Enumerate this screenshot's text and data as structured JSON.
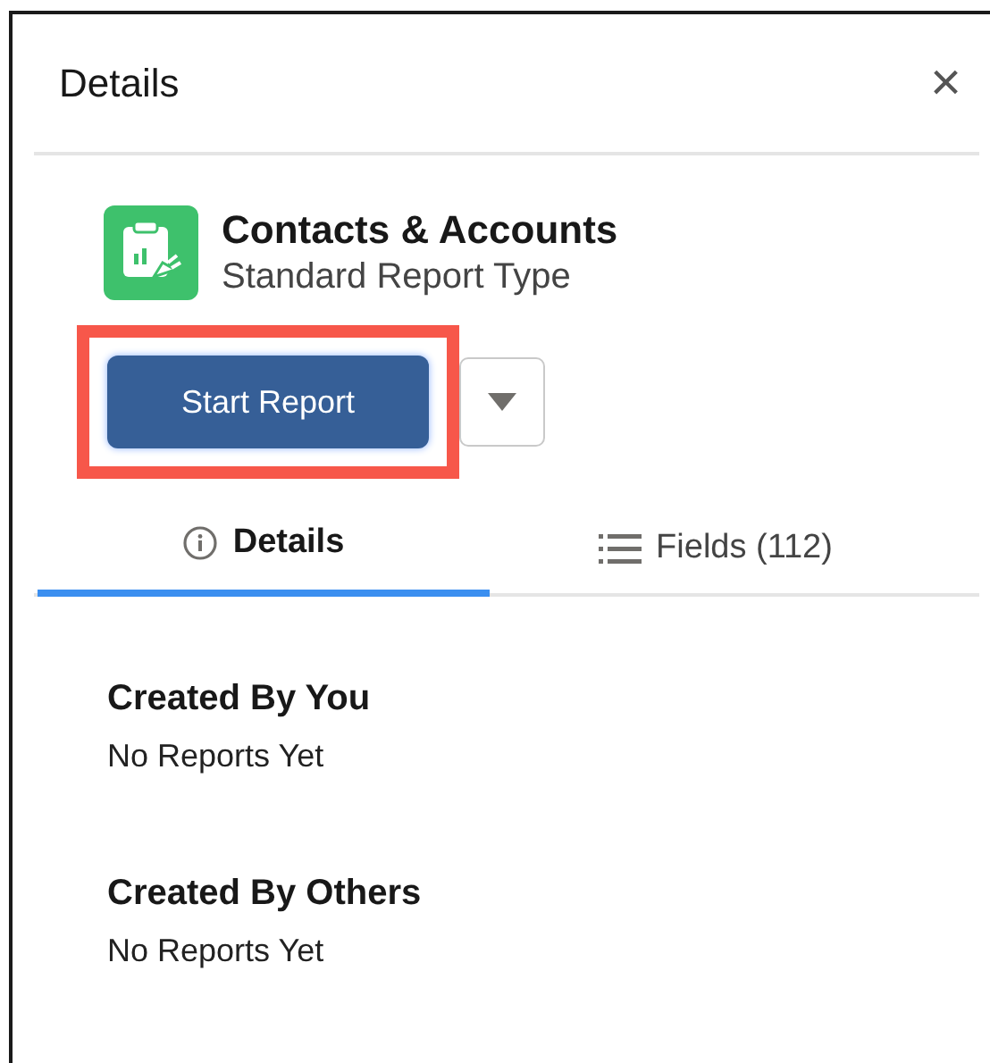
{
  "panel": {
    "title": "Details",
    "close": "×"
  },
  "report_type": {
    "name": "Contacts & Accounts",
    "subtitle": "Standard Report Type"
  },
  "start_button": {
    "label": "Start Report",
    "highlighted": true
  },
  "tabs": [
    {
      "kind": "info",
      "label": "Details",
      "selected": true
    },
    {
      "kind": "list",
      "label": "Fields (112)",
      "selected": false
    }
  ],
  "sections": [
    {
      "heading": "Created By You",
      "text": "No Reports Yet"
    },
    {
      "heading": "Created By Others",
      "text": "No Reports Yet"
    }
  ]
}
